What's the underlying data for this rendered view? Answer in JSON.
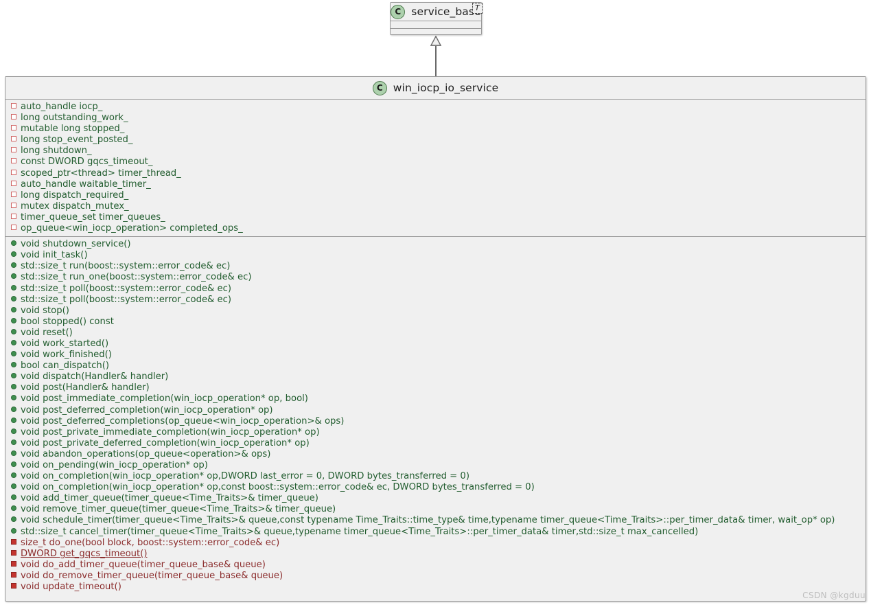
{
  "diagram": {
    "kind": "uml-class-diagram",
    "colors": {
      "box_fill": "#f0f0f0",
      "box_border": "#9a9a9a",
      "class_icon_fill": "#add1ad",
      "public_marker": "#3f8f4f",
      "private_marker": "#c3352f",
      "attribute_marker": "#d06262",
      "public_text": "#215c2e",
      "private_text": "#8a2b2b",
      "connector": "#6a6a6a",
      "watermark": "#bdbdbd"
    },
    "watermark": "CSDN @kgduu"
  },
  "base_class": {
    "icon": "class-circle-icon",
    "icon_letter": "C",
    "name": "service_base",
    "template_parameter": "T",
    "attributes": [],
    "operations": []
  },
  "derived_class": {
    "icon": "class-circle-icon",
    "icon_letter": "C",
    "name": "win_iocp_io_service",
    "attributes": [
      {
        "visibility": "private",
        "marker": "attr-private",
        "text": "auto_handle iocp_"
      },
      {
        "visibility": "private",
        "marker": "attr-private",
        "text": "long outstanding_work_"
      },
      {
        "visibility": "private",
        "marker": "attr-private",
        "text": "mutable long stopped_"
      },
      {
        "visibility": "private",
        "marker": "attr-private",
        "text": "long stop_event_posted_"
      },
      {
        "visibility": "private",
        "marker": "attr-private",
        "text": "long shutdown_"
      },
      {
        "visibility": "private",
        "marker": "attr-private",
        "text": "const DWORD gqcs_timeout_"
      },
      {
        "visibility": "private",
        "marker": "attr-private",
        "text": "scoped_ptr<thread> timer_thread_"
      },
      {
        "visibility": "private",
        "marker": "attr-private",
        "text": "auto_handle waitable_timer_"
      },
      {
        "visibility": "private",
        "marker": "attr-private",
        "text": "long dispatch_required_"
      },
      {
        "visibility": "private",
        "marker": "attr-private",
        "text": "mutex dispatch_mutex_"
      },
      {
        "visibility": "private",
        "marker": "attr-private",
        "text": "timer_queue_set timer_queues_"
      },
      {
        "visibility": "private",
        "marker": "attr-private",
        "text": "op_queue<win_iocp_operation> completed_ops_"
      }
    ],
    "operations": [
      {
        "visibility": "public",
        "marker": "op-public",
        "static": false,
        "text": "void shutdown_service()"
      },
      {
        "visibility": "public",
        "marker": "op-public",
        "static": false,
        "text": "void init_task()"
      },
      {
        "visibility": "public",
        "marker": "op-public",
        "static": false,
        "text": "std::size_t run(boost::system::error_code& ec)"
      },
      {
        "visibility": "public",
        "marker": "op-public",
        "static": false,
        "text": "std::size_t run_one(boost::system::error_code& ec)"
      },
      {
        "visibility": "public",
        "marker": "op-public",
        "static": false,
        "text": "std::size_t poll(boost::system::error_code& ec)"
      },
      {
        "visibility": "public",
        "marker": "op-public",
        "static": false,
        "text": "std::size_t poll(boost::system::error_code& ec)"
      },
      {
        "visibility": "public",
        "marker": "op-public",
        "static": false,
        "text": "void stop()"
      },
      {
        "visibility": "public",
        "marker": "op-public",
        "static": false,
        "text": "bool stopped() const"
      },
      {
        "visibility": "public",
        "marker": "op-public",
        "static": false,
        "text": "void reset()"
      },
      {
        "visibility": "public",
        "marker": "op-public",
        "static": false,
        "text": "void work_started()"
      },
      {
        "visibility": "public",
        "marker": "op-public",
        "static": false,
        "text": "void work_finished()"
      },
      {
        "visibility": "public",
        "marker": "op-public",
        "static": false,
        "text": "bool can_dispatch()"
      },
      {
        "visibility": "public",
        "marker": "op-public",
        "static": false,
        "text": "void dispatch(Handler& handler)"
      },
      {
        "visibility": "public",
        "marker": "op-public",
        "static": false,
        "text": "void post(Handler& handler)"
      },
      {
        "visibility": "public",
        "marker": "op-public",
        "static": false,
        "text": "void post_immediate_completion(win_iocp_operation* op, bool)"
      },
      {
        "visibility": "public",
        "marker": "op-public",
        "static": false,
        "text": "void post_deferred_completion(win_iocp_operation* op)"
      },
      {
        "visibility": "public",
        "marker": "op-public",
        "static": false,
        "text": "void post_deferred_completions(op_queue<win_iocp_operation>& ops)"
      },
      {
        "visibility": "public",
        "marker": "op-public",
        "static": false,
        "text": "void post_private_immediate_completion(win_iocp_operation* op)"
      },
      {
        "visibility": "public",
        "marker": "op-public",
        "static": false,
        "text": "void post_private_deferred_completion(win_iocp_operation* op)"
      },
      {
        "visibility": "public",
        "marker": "op-public",
        "static": false,
        "text": "void abandon_operations(op_queue<operation>& ops)"
      },
      {
        "visibility": "public",
        "marker": "op-public",
        "static": false,
        "text": "void on_pending(win_iocp_operation* op)"
      },
      {
        "visibility": "public",
        "marker": "op-public",
        "static": false,
        "text": "void on_completion(win_iocp_operation* op,DWORD last_error = 0, DWORD bytes_transferred = 0)"
      },
      {
        "visibility": "public",
        "marker": "op-public",
        "static": false,
        "text": "void on_completion(win_iocp_operation* op,const boost::system::error_code& ec, DWORD bytes_transferred = 0)"
      },
      {
        "visibility": "public",
        "marker": "op-public",
        "static": false,
        "text": "void add_timer_queue(timer_queue<Time_Traits>& timer_queue)"
      },
      {
        "visibility": "public",
        "marker": "op-public",
        "static": false,
        "text": "void remove_timer_queue(timer_queue<Time_Traits>& timer_queue)"
      },
      {
        "visibility": "public",
        "marker": "op-public",
        "static": false,
        "text": "void schedule_timer(timer_queue<Time_Traits>& queue,const typename Time_Traits::time_type& time,typename timer_queue<Time_Traits>::per_timer_data& timer, wait_op* op)"
      },
      {
        "visibility": "public",
        "marker": "op-public",
        "static": false,
        "text": "std::size_t cancel_timer(timer_queue<Time_Traits>& queue,typename timer_queue<Time_Traits>::per_timer_data& timer,std::size_t max_cancelled)"
      },
      {
        "visibility": "private",
        "marker": "op-private",
        "static": false,
        "text": "size_t do_one(bool block, boost::system::error_code& ec)"
      },
      {
        "visibility": "private",
        "marker": "op-private",
        "static": true,
        "text": "DWORD get_gqcs_timeout()"
      },
      {
        "visibility": "private",
        "marker": "op-private",
        "static": false,
        "text": "void do_add_timer_queue(timer_queue_base& queue)"
      },
      {
        "visibility": "private",
        "marker": "op-private",
        "static": false,
        "text": "void do_remove_timer_queue(timer_queue_base& queue)"
      },
      {
        "visibility": "private",
        "marker": "op-private",
        "static": false,
        "text": "void update_timeout()"
      }
    ]
  },
  "relationship": {
    "type": "generalization",
    "from": "win_iocp_io_service",
    "to": "service_base",
    "arrow": "hollow-triangle-arrow"
  }
}
